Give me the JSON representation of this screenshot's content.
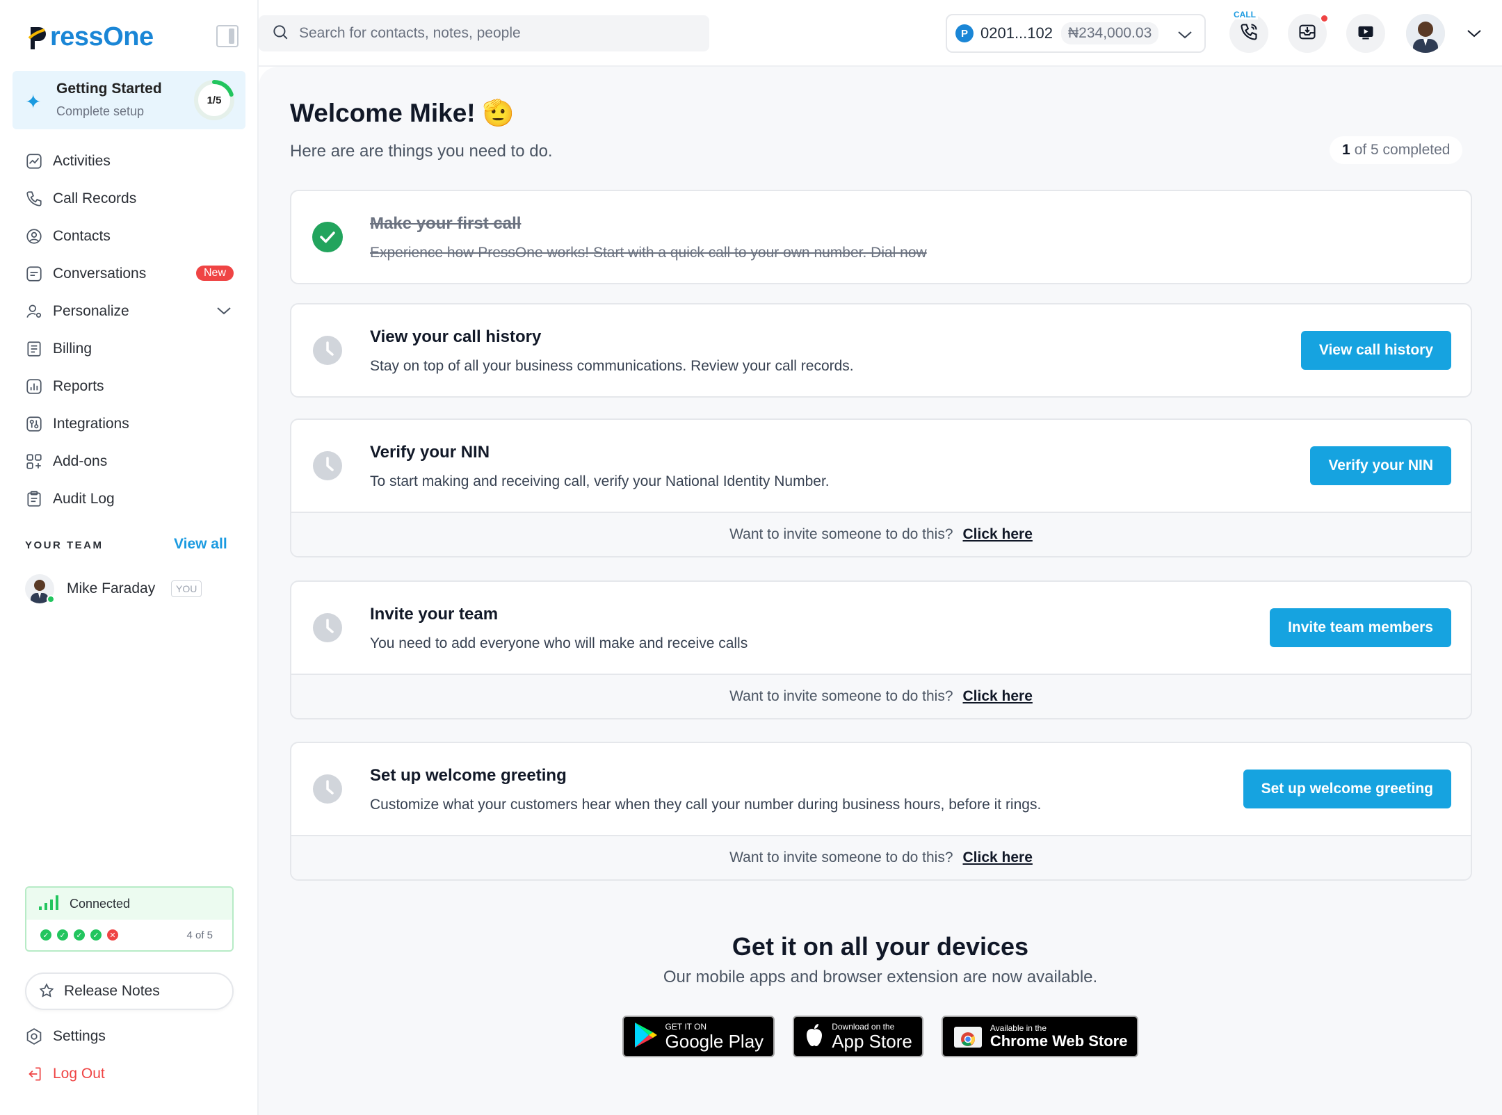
{
  "brand": {
    "name": "ressOne",
    "initial": "P",
    "color": "#1a86d6"
  },
  "sidebar": {
    "getting_started": {
      "title": "Getting Started",
      "subtitle": "Complete setup",
      "progress_label": "1/5",
      "progress": 0.2
    },
    "nav": [
      {
        "label": "Activities",
        "icon": "activity-icon"
      },
      {
        "label": "Call Records",
        "icon": "phone-icon"
      },
      {
        "label": "Contacts",
        "icon": "contact-icon"
      },
      {
        "label": "Conversations",
        "icon": "message-icon",
        "badge": "New"
      },
      {
        "label": "Personalize",
        "icon": "user-settings-icon"
      },
      {
        "label": "Billing",
        "icon": "receipt-icon"
      },
      {
        "label": "Reports",
        "icon": "report-icon"
      },
      {
        "label": "Integrations",
        "icon": "integration-icon"
      },
      {
        "label": "Add-ons",
        "icon": "addons-icon"
      },
      {
        "label": "Audit Log",
        "icon": "clipboard-icon"
      }
    ],
    "team": {
      "heading": "YOUR TEAM",
      "view_all": "View all",
      "member": {
        "name": "Mike Faraday",
        "badge": "YOU"
      }
    },
    "connection": {
      "label": "Connected",
      "count": "4 of 5",
      "statuses": [
        "ok",
        "ok",
        "ok",
        "ok",
        "err"
      ]
    },
    "release_notes": "Release Notes",
    "settings": "Settings",
    "logout": "Log Out"
  },
  "topbar": {
    "search_placeholder": "Search for contacts, notes, people",
    "account": {
      "badge": "P",
      "number": "0201...102",
      "balance": "₦234,000.03"
    },
    "call_tag": "CALL"
  },
  "main": {
    "welcome": "Welcome Mike! 🫡",
    "subtitle": "Here are are things you need to do.",
    "completed": {
      "count": "1",
      "text": "of 5 completed"
    },
    "tasks": [
      {
        "title": "Make your first call",
        "desc": "Experience how PressOne works! Start with a quick call to your own number. Dial now",
        "done": true
      },
      {
        "title": "View your call history",
        "desc": "Stay on top of all your business communications. Review your call records.",
        "button": "View call history"
      },
      {
        "title": "Verify your NIN",
        "desc": "To start making and receiving call, verify your National Identity Number.",
        "button": "Verify your NIN",
        "footer": "Want to invite someone to do this?",
        "footer_link": "Click here"
      },
      {
        "title": "Invite your team",
        "desc": "You need to add everyone who will make and receive calls",
        "button": "Invite team members",
        "footer": "Want to invite someone to do this?",
        "footer_link": "Click here"
      },
      {
        "title": "Set up welcome greeting",
        "desc": "Customize what your customers hear when they call your number during business hours, before it rings.",
        "button": "Set up welcome greeting",
        "footer": "Want to invite someone to do this?",
        "footer_link": "Click here"
      }
    ],
    "devices": {
      "title": "Get it on all your devices",
      "subtitle": "Our mobile apps and browser extension are now available.",
      "stores": [
        {
          "small": "GET IT ON",
          "big": "Google Play"
        },
        {
          "small": "Download on the",
          "big": "App Store"
        },
        {
          "small": "Available in the",
          "big": "Chrome Web Store"
        }
      ]
    }
  }
}
